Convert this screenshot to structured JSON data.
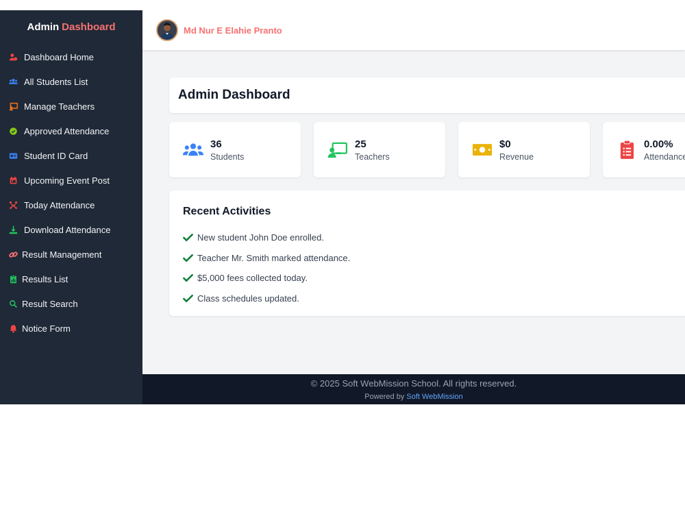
{
  "brand": {
    "part1": "Admin",
    "part2": "Dashboard"
  },
  "sidebar": {
    "items": [
      {
        "label": "Dashboard Home",
        "icon": "user-tie-icon",
        "color": "#ef4444"
      },
      {
        "label": "All Students List",
        "icon": "users-icon",
        "color": "#3b82f6"
      },
      {
        "label": "Manage Teachers",
        "icon": "chalkboard-teacher-icon",
        "color": "#f97316"
      },
      {
        "label": "Approved Attendance",
        "icon": "check-circle-icon",
        "color": "#84cc16"
      },
      {
        "label": "Student ID Card",
        "icon": "id-card-icon",
        "color": "#3b82f6"
      },
      {
        "label": "Upcoming Event Post",
        "icon": "calendar-icon",
        "color": "#ef4444"
      },
      {
        "label": "Today Attendance",
        "icon": "people-arrows-icon",
        "color": "#ef4444"
      },
      {
        "label": "Download Attendance",
        "icon": "download-icon",
        "color": "#22c55e"
      },
      {
        "label": "Result Management",
        "icon": "link-icon",
        "color": "#f87171"
      },
      {
        "label": "Results List",
        "icon": "clipboard-chart-icon",
        "color": "#22c55e"
      },
      {
        "label": "Result Search",
        "icon": "search-icon",
        "color": "#22c55e"
      },
      {
        "label": "Notice Form",
        "icon": "bell-icon",
        "color": "#ef4444"
      }
    ]
  },
  "topbar": {
    "user_name": "Md Nur E Elahie Pranto"
  },
  "main": {
    "title": "Admin Dashboard",
    "stats": [
      {
        "value": "36",
        "label": "Students",
        "icon": "users-icon",
        "color": "#3b82f6"
      },
      {
        "value": "25",
        "label": "Teachers",
        "icon": "chalkboard-teacher-icon",
        "color": "#22c55e"
      },
      {
        "value": "$0",
        "label": "Revenue",
        "icon": "money-bill-icon",
        "color": "#eab308"
      },
      {
        "value": "0.00%",
        "label": "Attendance",
        "icon": "clipboard-list-icon",
        "color": "#ef4444"
      }
    ],
    "activities": {
      "heading": "Recent Activities",
      "items": [
        "New student John Doe enrolled.",
        "Teacher Mr. Smith marked attendance.",
        "$5,000 fees collected today.",
        "Class schedules updated."
      ],
      "check_color": "#15803d"
    }
  },
  "footer": {
    "copyright": "© 2025 Soft WebMission School. All rights reserved.",
    "powered_prefix": "Powered by",
    "powered_link": "Soft WebMission"
  }
}
